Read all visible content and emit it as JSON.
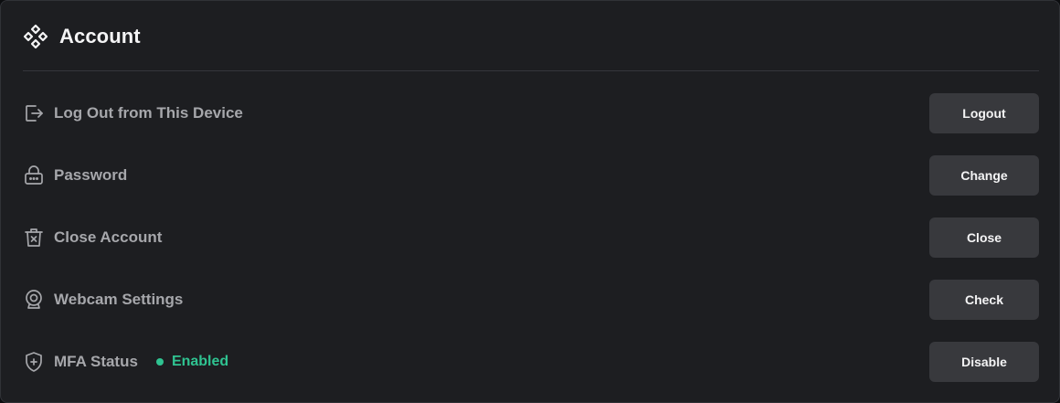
{
  "header": {
    "title": "Account",
    "logo_icon": "diamond-grid-icon"
  },
  "rows": [
    {
      "icon": "logout-icon",
      "label": "Log Out from This Device",
      "button": "Logout"
    },
    {
      "icon": "lock-icon",
      "label": "Password",
      "button": "Change"
    },
    {
      "icon": "trash-x-icon",
      "label": "Close Account",
      "button": "Close"
    },
    {
      "icon": "webcam-icon",
      "label": "Webcam Settings",
      "button": "Check"
    },
    {
      "icon": "shield-plus-icon",
      "label": "MFA Status",
      "button": "Disable",
      "status": "Enabled"
    }
  ],
  "colors": {
    "panel_background": "#1d1e21",
    "button_background": "#38393d",
    "status_green": "#2fc391",
    "label_gray": "#a6a7ab"
  }
}
